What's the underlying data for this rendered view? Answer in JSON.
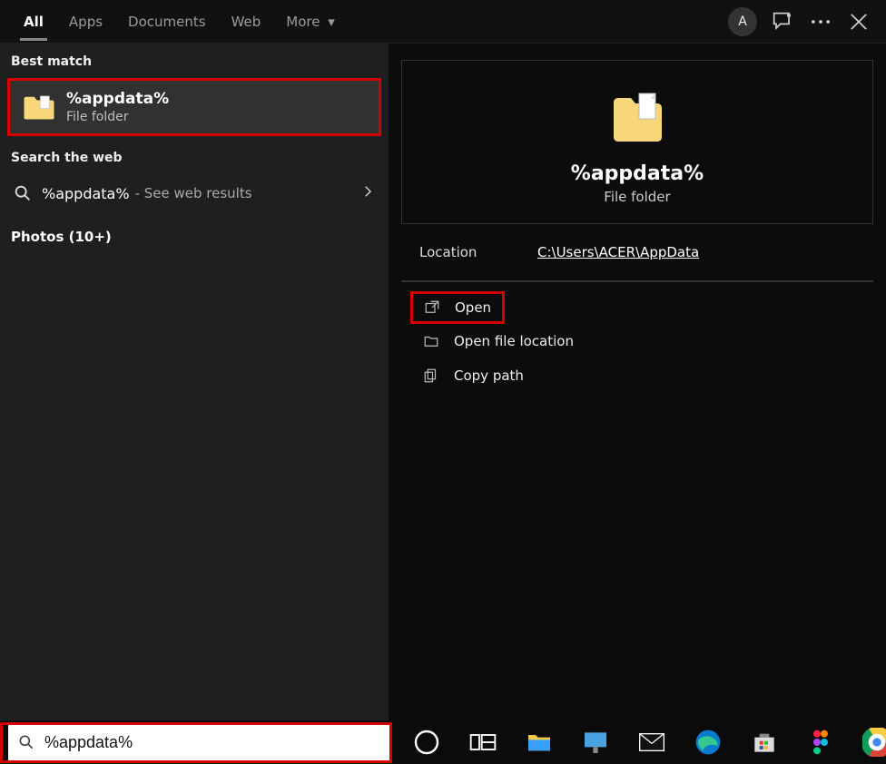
{
  "header": {
    "tabs": {
      "all": "All",
      "apps": "Apps",
      "documents": "Documents",
      "web": "Web",
      "more": "More"
    },
    "avatar": "A"
  },
  "left": {
    "best_match": "Best match",
    "result": {
      "title": "%appdata%",
      "sub": "File folder"
    },
    "search_web": "Search the web",
    "web": {
      "name": "%appdata%",
      "sub": " - See web results"
    },
    "photos": "Photos (10+)"
  },
  "preview": {
    "title": "%appdata%",
    "sub": "File folder",
    "location_label": "Location",
    "location_value": "C:\\Users\\ACER\\AppData"
  },
  "actions": {
    "open": "Open",
    "open_location": "Open file location",
    "copy_path": "Copy path"
  },
  "search": {
    "value": "%appdata%"
  }
}
